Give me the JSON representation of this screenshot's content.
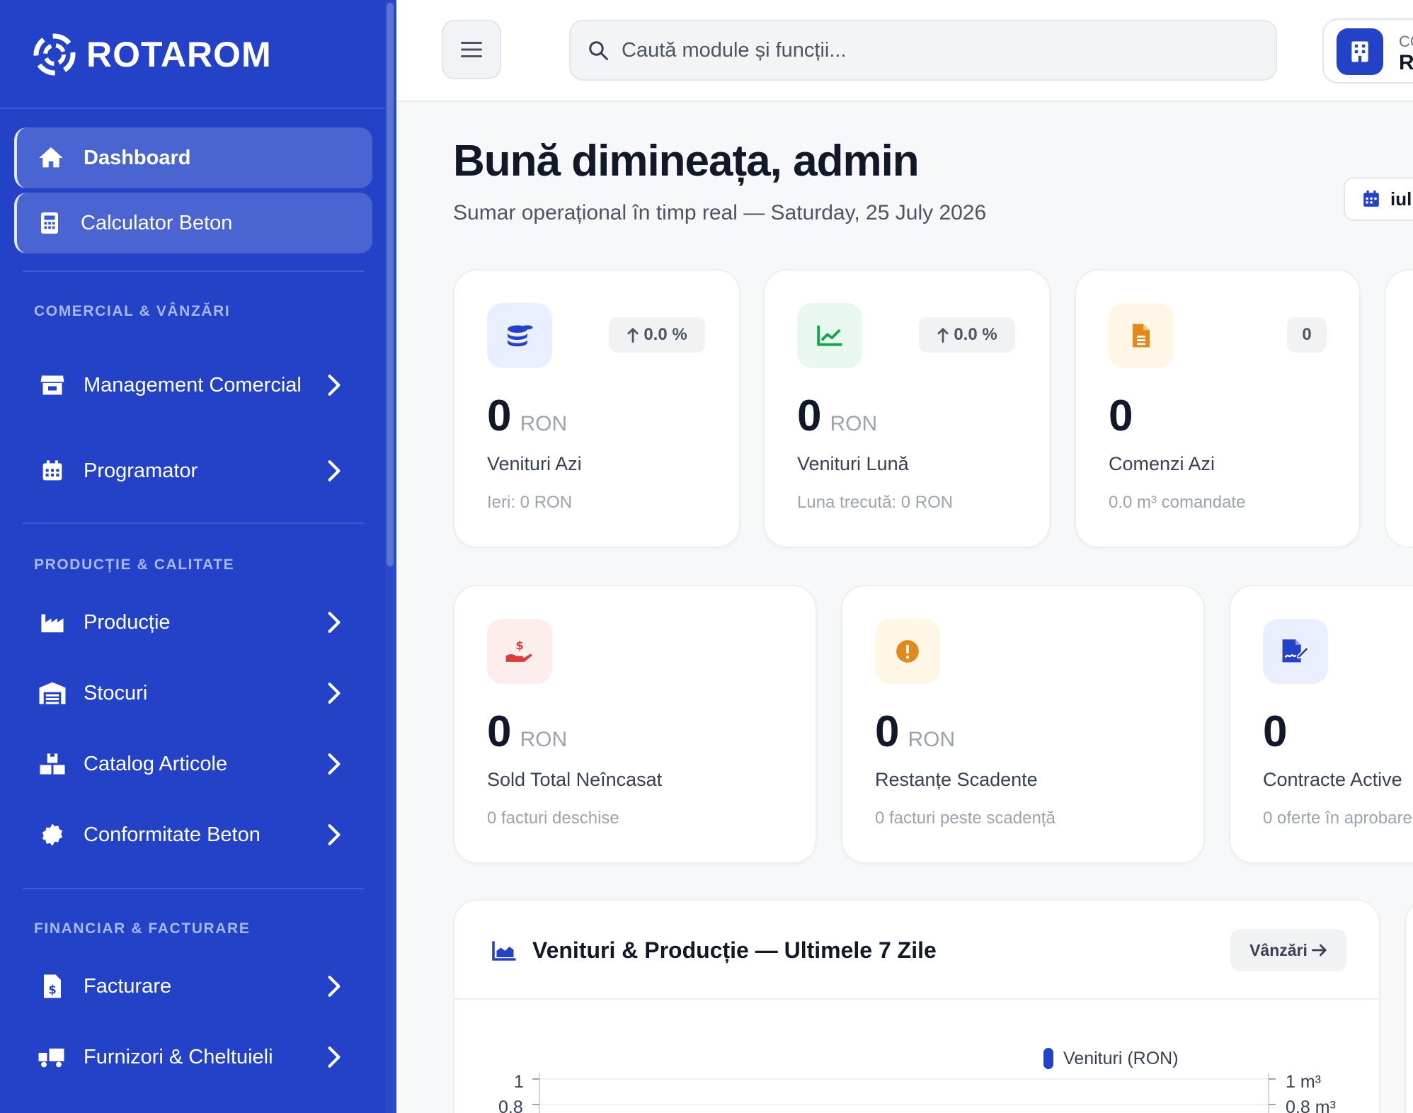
{
  "brand": {
    "name": "ROTAROM"
  },
  "sidebar": {
    "primary": [
      {
        "label": "Dashboard",
        "icon": "home-icon"
      },
      {
        "label": "Calculator Beton",
        "icon": "calculator-icon"
      }
    ],
    "groups": [
      {
        "label": "COMERCIAL & VÂNZĂRI",
        "items": [
          {
            "label": "Management Comercial",
            "icon": "store-icon"
          },
          {
            "label": "Programator",
            "icon": "calendar-icon"
          }
        ]
      },
      {
        "label": "PRODUCȚIE & CALITATE",
        "items": [
          {
            "label": "Producție",
            "icon": "factory-icon"
          },
          {
            "label": "Stocuri",
            "icon": "warehouse-icon"
          },
          {
            "label": "Catalog Articole",
            "icon": "boxes-icon"
          },
          {
            "label": "Conformitate Beton",
            "icon": "certificate-icon"
          }
        ]
      },
      {
        "label": "FINANCIAR & FACTURARE",
        "items": [
          {
            "label": "Facturare",
            "icon": "invoice-icon"
          },
          {
            "label": "Furnizori & Cheltuieli",
            "icon": "truck-icon"
          }
        ]
      }
    ]
  },
  "topbar": {
    "search_placeholder": "Caută module și funcții...",
    "company_top": "CO",
    "company_bottom": "RO"
  },
  "header": {
    "greeting": "Bună dimineața, admin",
    "subtitle": "Sumar operațional în timp real — Saturday, 25 July 2026",
    "date_pill": "iul"
  },
  "kpi_row1": [
    {
      "value": "0",
      "unit": "RON",
      "title": "Venituri Azi",
      "sub": "Ieri: 0 RON",
      "badge": "0.0 %",
      "icon": "coins-icon",
      "icon_color": "#2342c8",
      "icon_bg": "#e9efff"
    },
    {
      "value": "0",
      "unit": "RON",
      "title": "Venituri Lună",
      "sub": "Luna trecută: 0 RON",
      "badge": "0.0 %",
      "icon": "chart-line-icon",
      "icon_color": "#16a34a",
      "icon_bg": "#e8f8ee"
    },
    {
      "value": "0",
      "unit": "",
      "title": "Comenzi Azi",
      "sub": "0.0 m³ comandate",
      "badge": "0",
      "icon": "document-icon",
      "icon_color": "#e08a1e",
      "icon_bg": "#fff6e6"
    }
  ],
  "kpi_row2": [
    {
      "value": "0",
      "unit": "RON",
      "title": "Sold Total Neîncasat",
      "sub": "0 facturi deschise",
      "icon": "hand-dollar-icon",
      "icon_color": "#dc3b3b",
      "icon_bg": "#fdeeee"
    },
    {
      "value": "0",
      "unit": "RON",
      "title": "Restanțe Scadente",
      "sub": "0 facturi peste scadență",
      "icon": "alert-circle-icon",
      "icon_color": "#e08a1e",
      "icon_bg": "#fff6e6"
    },
    {
      "value": "0",
      "unit": "",
      "title": "Contracte Active",
      "sub": "0 oferte în aprobare",
      "icon": "signature-icon",
      "icon_color": "#2342c8",
      "icon_bg": "#e9efff"
    }
  ],
  "chart_panel": {
    "title": "Venituri & Producție — Ultimele 7 Zile",
    "link_label": "Vânzări",
    "icon": "area-chart-icon"
  },
  "chart_data": {
    "type": "line",
    "legend": [
      "Venituri (RON)"
    ],
    "y_left_ticks": [
      "1",
      "0.8"
    ],
    "y_right_ticks": [
      "1 m³",
      "0.8 m³"
    ],
    "series_color": "#2342c8"
  },
  "colors": {
    "sidebar": "#2342c8",
    "accent": "#2342c8",
    "background": "#f7f8fa"
  }
}
